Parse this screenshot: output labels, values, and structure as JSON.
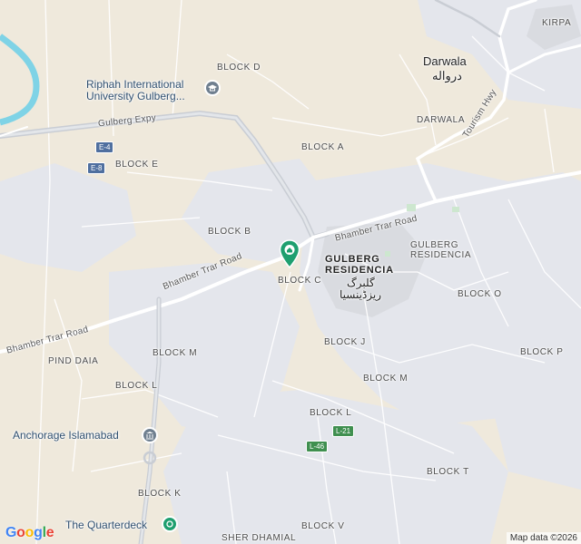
{
  "map": {
    "places": {
      "block_d": "BLOCK D",
      "block_a": "BLOCK A",
      "block_e": "BLOCK E",
      "block_b": "BLOCK B",
      "block_c": "BLOCK C",
      "block_m_w": "BLOCK M",
      "block_j": "BLOCK J",
      "block_m_e": "BLOCK M",
      "block_l_w": "BLOCK L",
      "block_l_e": "BLOCK L",
      "block_o": "BLOCK O",
      "block_p": "BLOCK P",
      "block_t": "BLOCK T",
      "block_k": "BLOCK K",
      "block_v": "BLOCK V",
      "pind_daia": "PIND DAIA",
      "sher_dhamial": "SHER DHAMIAL",
      "darwala_small": "DARWALA",
      "kirpa": "KIRPA",
      "gulberg_residencia_small_1": "GULBERG",
      "gulberg_residencia_small_2": "RESIDENCIA"
    },
    "towns": {
      "darwala": "Darwala",
      "darwala_urdu": "درواله"
    },
    "featured": {
      "line1": "GULBERG",
      "line2": "RESIDENCIA",
      "urdu1": "گلبرگ",
      "urdu2": "ریزڈینسیا"
    },
    "pois": {
      "riphah_1": "Riphah International",
      "riphah_2": "University Gulberg...",
      "anchorage": "Anchorage Islamabad",
      "quarterdeck": "The Quarterdeck"
    },
    "roads": {
      "gulberg_expy": "Gulberg Expy",
      "bhamber_trar_1": "Bhamber Trar Road",
      "bhamber_trar_2": "Bhamber Trar Road",
      "bhamber_trar_3": "Bhamber Trar Road",
      "tourism_hwy": "Tourism Hwy"
    },
    "shields": {
      "e4": "E-4",
      "e8": "E-8",
      "l21": "L-21",
      "l46": "L-46"
    },
    "footer": {
      "google": [
        "G",
        "o",
        "o",
        "g",
        "l",
        "e"
      ],
      "google_colors": [
        "#4285F4",
        "#EA4335",
        "#FBBC05",
        "#4285F4",
        "#34A853",
        "#EA4335"
      ],
      "attribution": "Map data ©2026"
    },
    "colors": {
      "land": "#efe9dc",
      "urban": "#e6e7ec",
      "water": "#7fd3e6",
      "road": "#ffffff",
      "highway": "#c9cdd4",
      "pin": "#1e9f6f"
    }
  }
}
